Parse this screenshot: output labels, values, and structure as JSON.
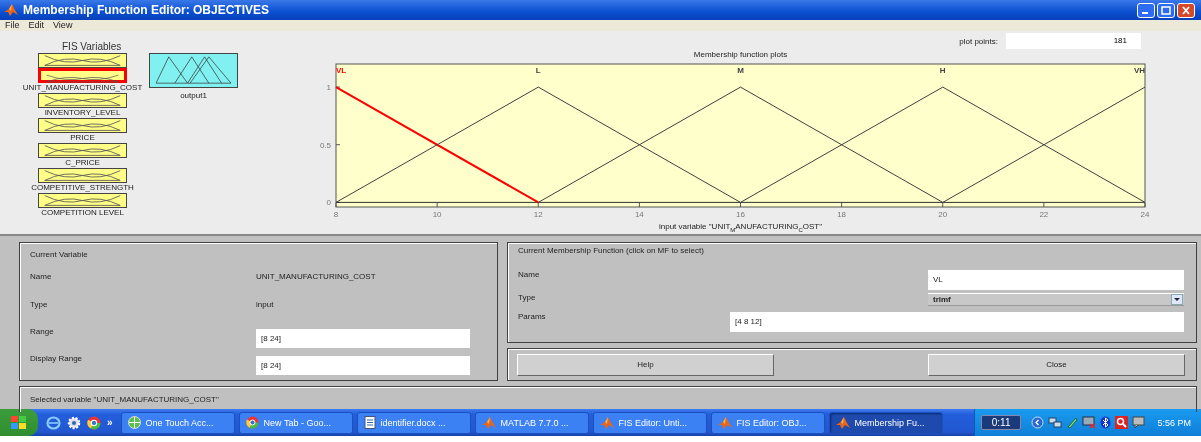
{
  "window": {
    "title": "Membership Function Editor: OBJECTIVES"
  },
  "menu": [
    "File",
    "Edit",
    "View"
  ],
  "fis_variables": {
    "title": "FIS Variables",
    "inputs": [
      {
        "selected": false
      },
      {
        "label": "UNIT_MANUFACTURING_COST",
        "selected": true
      },
      {
        "label": "INVENTORY_LEVEL",
        "selected": false
      },
      {
        "label": "PRICE",
        "selected": false
      },
      {
        "label": "C_PRICE",
        "selected": false
      },
      {
        "label": "COMPETITIVE_STRENGTH",
        "selected": false
      },
      {
        "label": "COMPETITION LEVEL",
        "selected": false
      }
    ],
    "output": {
      "label": "output1",
      "selected": false
    }
  },
  "plot": {
    "title": "Membership function plots",
    "plot_points_label": "plot points:",
    "plot_points": "181",
    "chart_data": {
      "type": "line",
      "xlabel": "input variable \"UNIT$_{M}$ANUFACTURING$_{C}$OST\"",
      "x": [
        8,
        12,
        16,
        20,
        24
      ],
      "series": [
        {
          "name": "VL",
          "color": "#ff0000",
          "values": [
            1,
            0,
            null,
            null,
            null
          ]
        },
        {
          "name": "L",
          "color": "#404040",
          "values": [
            0,
            1,
            0,
            null,
            null
          ]
        },
        {
          "name": "M",
          "color": "#404040",
          "values": [
            null,
            0,
            1,
            0,
            null
          ]
        },
        {
          "name": "H",
          "color": "#404040",
          "values": [
            null,
            null,
            0,
            1,
            0
          ]
        },
        {
          "name": "VH",
          "color": "#404040",
          "values": [
            null,
            null,
            null,
            0,
            1
          ]
        }
      ],
      "legend": "top",
      "xlim": [
        8,
        24
      ],
      "ylim": [
        -0.04,
        1.2
      ],
      "xticks": [
        8,
        10,
        12,
        14,
        16,
        18,
        20,
        22,
        24
      ],
      "yticks": [
        0,
        0.5,
        {
          "value": 1,
          "label": "1"
        }
      ]
    }
  },
  "current_variable": {
    "title": "Current Variable",
    "name_label": "Name",
    "name": "UNIT_MANUFACTURING_COST",
    "type_label": "Type",
    "type": "input",
    "range_label": "Range",
    "range": "[8 24]",
    "display_range_label": "Display Range",
    "display_range": "[8 24]"
  },
  "current_mf": {
    "title": "Current Membership Function (click on MF to select)",
    "name_label": "Name",
    "name": "VL",
    "type_label": "Type",
    "type": "trimf",
    "params_label": "Params",
    "params": "[4 8 12]"
  },
  "buttons": [
    "Help",
    "Close"
  ],
  "status": "Selected variable \"UNIT_MANUFACTURING_COST\"",
  "taskbar": {
    "quick_launch_more": "»",
    "tasks": [
      {
        "label": "One Touch Acc...",
        "kind": "globe",
        "selected": false
      },
      {
        "label": "New Tab - Goo...",
        "kind": "browser",
        "selected": false
      },
      {
        "label": "identifier.docx ...",
        "kind": "document",
        "selected": false
      },
      {
        "label": "MATLAB 7.7.0 ...",
        "kind": "matlab",
        "selected": false
      },
      {
        "label": "FIS Editor: Unti...",
        "kind": "matlab",
        "selected": false
      },
      {
        "label": "FIS Editor: OBJ...",
        "kind": "matlab",
        "selected": false
      },
      {
        "label": "Membership Fu...",
        "kind": "matlab",
        "selected": true
      }
    ],
    "timer": "0:11",
    "clock": "5:56 PM"
  }
}
